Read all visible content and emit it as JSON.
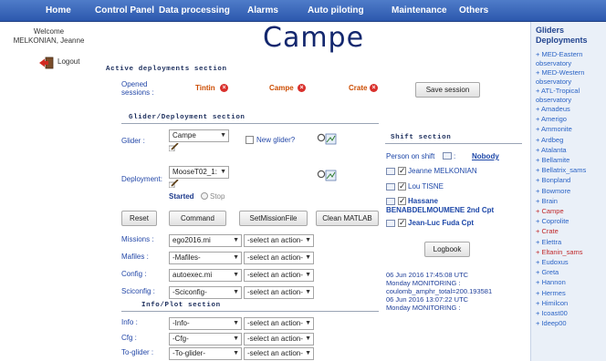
{
  "nav": {
    "items": [
      {
        "label": "Home"
      },
      {
        "label": "Control Panel"
      },
      {
        "label": "Data processing"
      },
      {
        "label": "Alarms"
      },
      {
        "label": "Auto piloting"
      },
      {
        "label": "Maintenance"
      },
      {
        "label": "Others"
      }
    ]
  },
  "left": {
    "welcome_line1": "Welcome",
    "welcome_line2": "MELKONIAN, Jeanne",
    "logout_label": "Logout"
  },
  "page": {
    "title": "Campe"
  },
  "active": {
    "heading": "Active deployments section",
    "opened_label_1": "Opened",
    "opened_label_2": "sessions :",
    "sessions": [
      {
        "name": "Tintin"
      },
      {
        "name": "Campe"
      },
      {
        "name": "Crate"
      }
    ],
    "save_button": "Save session"
  },
  "glider_section": {
    "heading": "Glider/Deployment section",
    "glider_label": "Glider :",
    "glider_value": "Campe",
    "new_glider_label": "New glider?",
    "deployment_label": "Deployment:",
    "deployment_value": "MooseT02_1:",
    "started_label": "Started",
    "stop_label": "Stop",
    "buttons": {
      "reset": "Reset",
      "command": "Command",
      "setmission": "SetMissionFile",
      "clean": "Clean MATLAB"
    },
    "rows": [
      {
        "label": "Missions :",
        "value": "ego2016.mi",
        "action": "-select an action-"
      },
      {
        "label": "Mafiles :",
        "value": "-Mafiles-",
        "action": "-select an action-"
      },
      {
        "label": "Config :",
        "value": "autoexec.mi",
        "action": "-select an action-"
      },
      {
        "label": "Sciconfig :",
        "value": "-Sciconfig-",
        "action": "-select an action-"
      }
    ]
  },
  "info_section": {
    "heading": "Info/Plot section",
    "rows": [
      {
        "label": "Info :",
        "value": "-Info-",
        "action": "-select an action-"
      },
      {
        "label": "Cfg :",
        "value": "-Cfg-",
        "action": "-select an action-"
      },
      {
        "label": "To-glider :",
        "value": "-To-glider-",
        "action": "-select an action-"
      }
    ]
  },
  "shift": {
    "heading": "Shift section",
    "person_label": "Person on shift",
    "person_value": "Nobody",
    "people": {
      "p1": "Jeanne MELKONIAN",
      "p2": "Lou TISNE",
      "p3a": "Hassane",
      "p3b": "BENABDELMOUMENE 2nd Cpt",
      "p4": "Jean-Luc Fuda Cpt"
    },
    "logbook_button": "Logbook",
    "log_lines": [
      "06 Jun 2016 17:45:08 UTC",
      "Monday MONITORING :",
      "coulomb_amphr_total=200.193581",
      "06 Jun 2016 13:07:22 UTC",
      "Monday MONITORING :"
    ]
  },
  "right": {
    "title_1": "Gliders",
    "title_2": "Deployments",
    "items": [
      {
        "label": "+ MED-Eastern observatory",
        "lines": 2
      },
      {
        "label": "+ MED-Western observatory",
        "lines": 2
      },
      {
        "label": "+ ATL-Tropical observatory",
        "lines": 2
      },
      {
        "label": "+ Amadeus",
        "lines": 1
      },
      {
        "label": "+ Amerigo",
        "lines": 1
      },
      {
        "label": "+ Ammonite",
        "lines": 1
      },
      {
        "label": "+ Ardbeg",
        "lines": 1
      },
      {
        "label": "+ Atalanta",
        "lines": 1
      },
      {
        "label": "+ Bellamite",
        "lines": 1
      },
      {
        "label": "+ Bellatrix_sams",
        "lines": 1
      },
      {
        "label": "+ Bonpland",
        "lines": 1
      },
      {
        "label": "+ Bowmore",
        "lines": 1
      },
      {
        "label": "+ Brain",
        "lines": 1
      },
      {
        "label": "+ Campe",
        "lines": 1,
        "red": true
      },
      {
        "label": "+ Coprolite",
        "lines": 1
      },
      {
        "label": "+ Crate",
        "lines": 1,
        "red": true
      },
      {
        "label": "+ Elettra",
        "lines": 1
      },
      {
        "label": "+ Eltanin_sams",
        "lines": 1,
        "red": true
      },
      {
        "label": "+ Eudoxus",
        "lines": 1
      },
      {
        "label": "+ Greta",
        "lines": 1
      },
      {
        "label": "+ Hannon",
        "lines": 1
      },
      {
        "label": "+ Hermes",
        "lines": 1
      },
      {
        "label": "+ Himilcon",
        "lines": 1
      },
      {
        "label": "+ Icoast00",
        "lines": 1
      },
      {
        "label": "+ Ideep00",
        "lines": 1
      }
    ]
  },
  "colors": {
    "nav_bg": "#2c58ad",
    "link_blue": "#2a63c5",
    "session_orange": "#cc4c00",
    "close_red": "#d9302c",
    "active_red": "#c0282a"
  }
}
